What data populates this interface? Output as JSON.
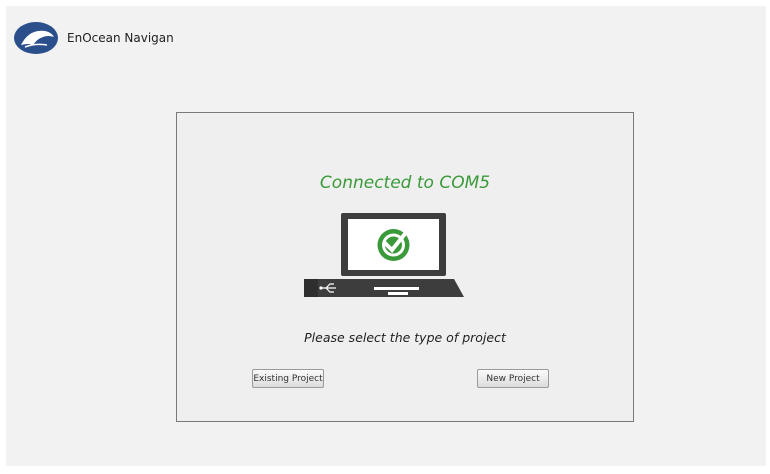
{
  "app": {
    "title": "EnOcean Navigan"
  },
  "dialog": {
    "status": "Connected to COM5",
    "prompt": "Please select the type of project",
    "buttons": {
      "existing": "Existing Project",
      "new": "New Project"
    }
  },
  "icons": {
    "logo": "dolphin-logo-icon",
    "status": "checkmark-circle-icon",
    "device": "laptop-icon",
    "usb": "usb-icon"
  },
  "colors": {
    "status_green": "#3a9a3a",
    "logo_blue": "#2b4f8a",
    "laptop_dark": "#3d3d3d"
  }
}
